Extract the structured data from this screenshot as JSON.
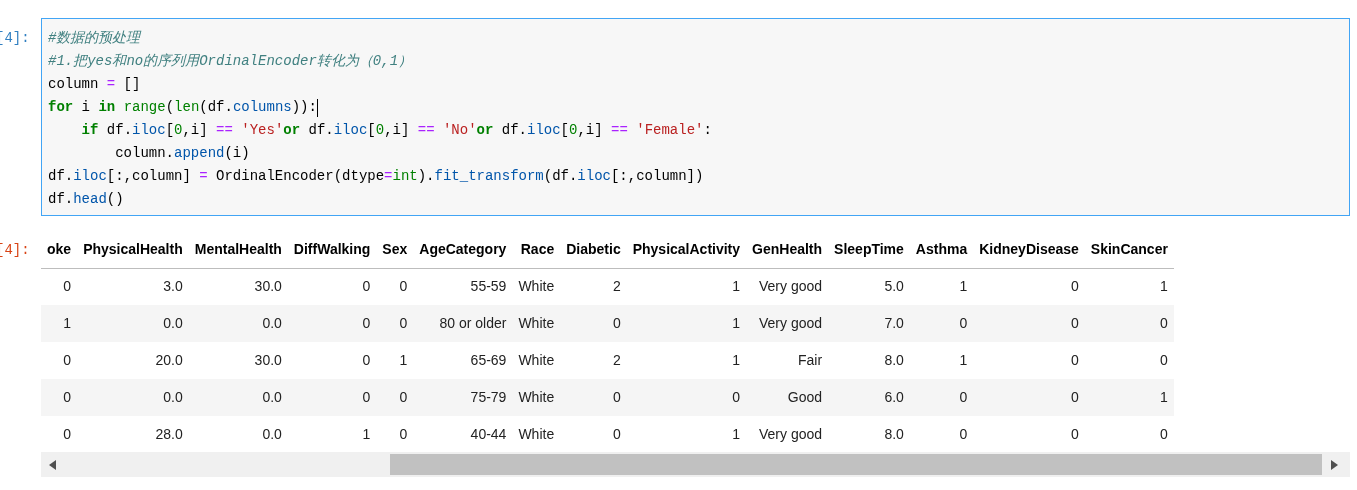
{
  "input_cell": {
    "prompt": "[4]:",
    "lines": [
      {
        "tokens": [
          {
            "kind": "comment",
            "text": "#数据的预处理"
          }
        ]
      },
      {
        "tokens": [
          {
            "kind": "comment",
            "text": "#1.把yes和no的序列用OrdinalEncoder转化为（0,1）"
          }
        ]
      },
      {
        "tokens": [
          {
            "kind": "plain",
            "text": "column "
          },
          {
            "kind": "op",
            "text": "="
          },
          {
            "kind": "plain",
            "text": " []"
          }
        ]
      },
      {
        "cursor": true,
        "tokens": [
          {
            "kind": "keyword",
            "text": "for"
          },
          {
            "kind": "plain",
            "text": " i "
          },
          {
            "kind": "keyword",
            "text": "in "
          },
          {
            "kind": "builtin",
            "text": "range"
          },
          {
            "kind": "plain",
            "text": "("
          },
          {
            "kind": "builtin",
            "text": "len"
          },
          {
            "kind": "plain",
            "text": "(df."
          },
          {
            "kind": "attr",
            "text": "columns"
          },
          {
            "kind": "plain",
            "text": ")):"
          }
        ]
      },
      {
        "tokens": [
          {
            "kind": "keyword",
            "text": "    if"
          },
          {
            "kind": "plain",
            "text": " df."
          },
          {
            "kind": "attr",
            "text": "iloc"
          },
          {
            "kind": "plain",
            "text": "["
          },
          {
            "kind": "number",
            "text": "0"
          },
          {
            "kind": "plain",
            "text": ",i] "
          },
          {
            "kind": "op",
            "text": "== "
          },
          {
            "kind": "string",
            "text": "'Yes'"
          },
          {
            "kind": "keyword",
            "text": "or"
          },
          {
            "kind": "plain",
            "text": " df."
          },
          {
            "kind": "attr",
            "text": "iloc"
          },
          {
            "kind": "plain",
            "text": "["
          },
          {
            "kind": "number",
            "text": "0"
          },
          {
            "kind": "plain",
            "text": ",i] "
          },
          {
            "kind": "op",
            "text": "== "
          },
          {
            "kind": "string",
            "text": "'No'"
          },
          {
            "kind": "keyword",
            "text": "or"
          },
          {
            "kind": "plain",
            "text": " df."
          },
          {
            "kind": "attr",
            "text": "iloc"
          },
          {
            "kind": "plain",
            "text": "["
          },
          {
            "kind": "number",
            "text": "0"
          },
          {
            "kind": "plain",
            "text": ",i] "
          },
          {
            "kind": "op",
            "text": "== "
          },
          {
            "kind": "string",
            "text": "'Female'"
          },
          {
            "kind": "plain",
            "text": ":"
          }
        ]
      },
      {
        "tokens": [
          {
            "kind": "plain",
            "text": "        column."
          },
          {
            "kind": "attr",
            "text": "append"
          },
          {
            "kind": "plain",
            "text": "(i)"
          }
        ]
      },
      {
        "tokens": [
          {
            "kind": "plain",
            "text": "df."
          },
          {
            "kind": "attr",
            "text": "iloc"
          },
          {
            "kind": "plain",
            "text": "[:,column] "
          },
          {
            "kind": "op",
            "text": "="
          },
          {
            "kind": "plain",
            "text": " OrdinalEncoder(dtype"
          },
          {
            "kind": "op",
            "text": "="
          },
          {
            "kind": "builtin",
            "text": "int"
          },
          {
            "kind": "plain",
            "text": ")."
          },
          {
            "kind": "attr",
            "text": "fit_transform"
          },
          {
            "kind": "plain",
            "text": "(df."
          },
          {
            "kind": "attr",
            "text": "iloc"
          },
          {
            "kind": "plain",
            "text": "[:,column])"
          }
        ]
      },
      {
        "tokens": [
          {
            "kind": "plain",
            "text": "df."
          },
          {
            "kind": "attr",
            "text": "head"
          },
          {
            "kind": "plain",
            "text": "()"
          }
        ]
      }
    ]
  },
  "output_cell": {
    "prompt": "[4]:",
    "table": {
      "columns": [
        "oke",
        "PhysicalHealth",
        "MentalHealth",
        "DiffWalking",
        "Sex",
        "AgeCategory",
        "Race",
        "Diabetic",
        "PhysicalActivity",
        "GenHealth",
        "SleepTime",
        "Asthma",
        "KidneyDisease",
        "SkinCancer"
      ],
      "rows": [
        [
          "0",
          "3.0",
          "30.0",
          "0",
          "0",
          "55-59",
          "White",
          "2",
          "1",
          "Very good",
          "5.0",
          "1",
          "0",
          "1"
        ],
        [
          "1",
          "0.0",
          "0.0",
          "0",
          "0",
          "80 or older",
          "White",
          "0",
          "1",
          "Very good",
          "7.0",
          "0",
          "0",
          "0"
        ],
        [
          "0",
          "20.0",
          "30.0",
          "0",
          "1",
          "65-69",
          "White",
          "2",
          "1",
          "Fair",
          "8.0",
          "1",
          "0",
          "0"
        ],
        [
          "0",
          "0.0",
          "0.0",
          "0",
          "0",
          "75-79",
          "White",
          "0",
          "0",
          "Good",
          "6.0",
          "0",
          "0",
          "1"
        ],
        [
          "0",
          "28.0",
          "0.0",
          "1",
          "0",
          "40-44",
          "White",
          "0",
          "1",
          "Very good",
          "8.0",
          "0",
          "0",
          "0"
        ]
      ]
    }
  }
}
